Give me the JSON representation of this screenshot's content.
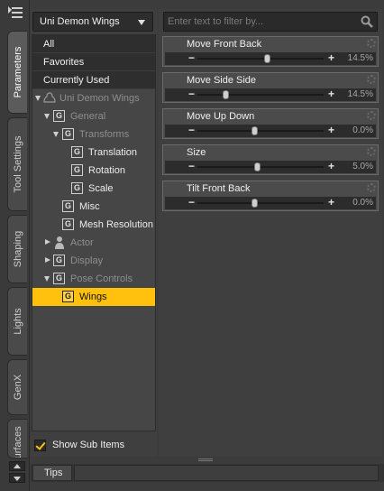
{
  "tabs": [
    {
      "label": "Parameters",
      "active": true
    },
    {
      "label": "Tool Settings",
      "active": false
    },
    {
      "label": "Shaping",
      "active": false
    },
    {
      "label": "Lights",
      "active": false
    },
    {
      "label": "GenX",
      "active": false
    },
    {
      "label": "Surfaces",
      "active": false
    }
  ],
  "left_panel": {
    "selector": {
      "value": "Uni Demon Wings"
    },
    "filters": [
      "All",
      "Favorites",
      "Currently Used"
    ],
    "tree": {
      "root": "Uni Demon Wings",
      "general": "General",
      "transforms": "Transforms",
      "translation": "Translation",
      "rotation": "Rotation",
      "scale": "Scale",
      "misc": "Misc",
      "mesh_resolution": "Mesh Resolution",
      "actor": "Actor",
      "display": "Display",
      "pose_controls": "Pose Controls",
      "wings": "Wings"
    },
    "group_icon_glyph": "G",
    "show_sub_items": {
      "label": "Show Sub Items",
      "checked": true
    }
  },
  "filter_placeholder": "Enter text to filter by...",
  "parameters": [
    {
      "name": "Move Front Back",
      "value": "14.5%",
      "level": 0.55
    },
    {
      "name": "Move Side Side",
      "value": "14.5%",
      "level": 0.22
    },
    {
      "name": "Move Up Down",
      "value": "0.0%",
      "level": 0.45
    },
    {
      "name": "Size",
      "value": "5.0%",
      "level": 0.47
    },
    {
      "name": "Tilt Front Back",
      "value": "0.0%",
      "level": 0.45
    }
  ],
  "slider_symbols": {
    "minus": "−",
    "plus": "+"
  },
  "bottom_tabs": [
    "Tips"
  ],
  "colors": {
    "selection": "#ffc10e",
    "panel": "#3f3f3f",
    "param_bg": "#4b4b4b"
  }
}
